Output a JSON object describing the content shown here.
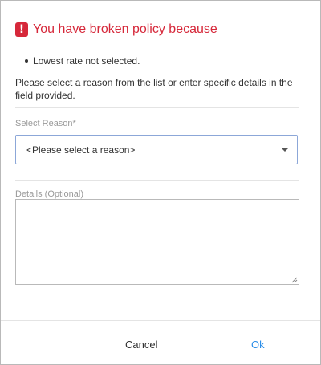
{
  "header": {
    "icon": "exclamation-icon",
    "title": "You have broken policy because",
    "accent_color": "#d6283a"
  },
  "violations": [
    "Lowest rate not selected."
  ],
  "instruction": "Please select a reason from the list or enter specific details in the field provided.",
  "reason": {
    "label": "Select Reason*",
    "selected": "<Please select a reason>"
  },
  "details": {
    "label": "Details (Optional)",
    "value": ""
  },
  "footer": {
    "cancel_label": "Cancel",
    "ok_label": "Ok",
    "ok_color": "#2b8ee8"
  }
}
